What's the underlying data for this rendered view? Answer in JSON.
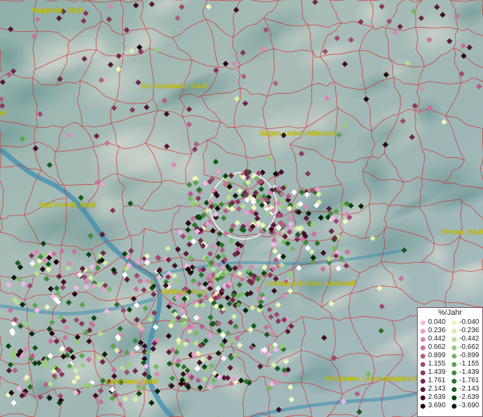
{
  "cities": [
    {
      "id": "wuppertal",
      "label": "Wuppertal, Stadt"
    },
    {
      "id": "gummersbach",
      "label": "Gummersbach, Stadt"
    },
    {
      "id": "siegen",
      "label": "Siegen, Universitätsstadt"
    },
    {
      "id": "bad-honnef",
      "label": "Bad Honnef, Stadt"
    },
    {
      "id": "wetzlar",
      "label": "Wetzlar, Stadt"
    },
    {
      "id": "koblenz",
      "label": "Koblenz, Stadt"
    },
    {
      "id": "limburg",
      "label": "Limburg a.d. Lahn, Kreisstadt"
    },
    {
      "id": "kastellaun",
      "label": "Kastellaun, Stadt"
    },
    {
      "id": "wiesbaden",
      "label": "Wiesbaden, Landeshauptstadt"
    },
    {
      "id": "edge-left",
      "label": "dt"
    }
  ],
  "legend": {
    "title": "%/Jahr",
    "positive": [
      {
        "value": "0.040",
        "color": "#f2b8e8"
      },
      {
        "value": "0.236",
        "color": "#e6a0cc"
      },
      {
        "value": "0.442",
        "color": "#d889b4"
      },
      {
        "value": "0.662",
        "color": "#c7729c"
      },
      {
        "value": "0.899",
        "color": "#b45d86"
      },
      {
        "value": "1.155",
        "color": "#9e4a70"
      },
      {
        "value": "1.439",
        "color": "#88385c"
      },
      {
        "value": "1.761",
        "color": "#712848"
      },
      {
        "value": "2.143",
        "color": "#5a1a36"
      },
      {
        "value": "2.639",
        "color": "#420e24"
      },
      {
        "value": "3.690",
        "color": "#240410"
      }
    ],
    "negative": [
      {
        "value": "-0.040",
        "color": "#eef7b8"
      },
      {
        "value": "-0.236",
        "color": "#d6efa6"
      },
      {
        "value": "-0.442",
        "color": "#b8e08e"
      },
      {
        "value": "-0.662",
        "color": "#98cd78"
      },
      {
        "value": "-0.899",
        "color": "#78b862"
      },
      {
        "value": "-1.155",
        "color": "#5ba24e"
      },
      {
        "value": "-1.439",
        "color": "#418a3c"
      },
      {
        "value": "-1.761",
        "color": "#2c732c"
      },
      {
        "value": "-2.143",
        "color": "#1a5c1e"
      },
      {
        "value": "-2.639",
        "color": "#0e4412"
      },
      {
        "value": "-3.690",
        "color": "#042408"
      }
    ]
  },
  "colors": {
    "boundary": "#d42a2a",
    "river": "#3f8fb0",
    "city_label": "#e8e000",
    "selection_circle": "#f4f4f4"
  }
}
